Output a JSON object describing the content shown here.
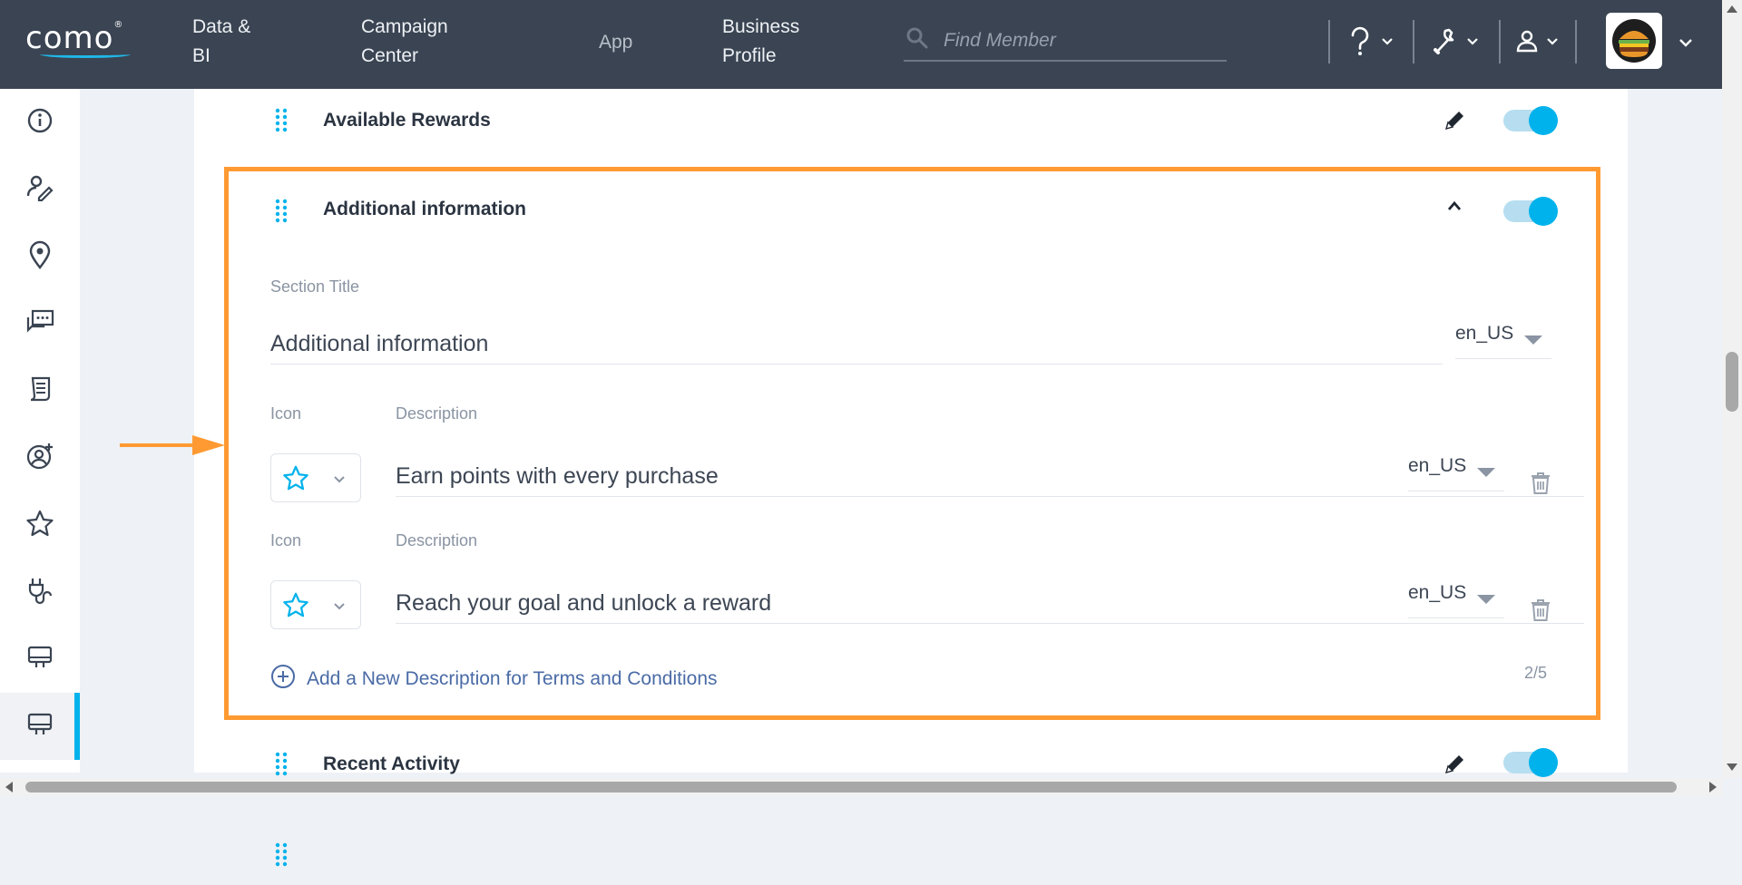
{
  "header": {
    "logo_text": "como",
    "logo_mark": "®",
    "nav": [
      {
        "line1": "Data &",
        "line2": "BI"
      },
      {
        "line1": "Campaign",
        "line2": "Center"
      },
      {
        "line1": "App",
        "line2": ""
      },
      {
        "line1": "Business",
        "line2": "Profile"
      }
    ],
    "search_placeholder": "Find Member",
    "icons": [
      "help-icon",
      "wrench-icon",
      "user-icon"
    ],
    "avatar": "burger-logo"
  },
  "sidebar": {
    "items": [
      "info-icon",
      "user-edit-icon",
      "location-pin-icon",
      "chat-icon",
      "receipt-icon",
      "user-add-icon",
      "star-icon",
      "plug-icon",
      "monitor-icon",
      "monitor-icon"
    ],
    "active_index": 9
  },
  "sections": {
    "available_rewards": {
      "title": "Available Rewards",
      "enabled": true
    },
    "additional_info": {
      "title": "Additional information",
      "enabled": true,
      "section_title_label": "Section Title",
      "section_title_value": "Additional information",
      "section_title_locale": "en_US",
      "icon_label": "Icon",
      "description_label": "Description",
      "descriptions": [
        {
          "icon": "star-icon",
          "text": "Earn points with every purchase",
          "locale": "en_US"
        },
        {
          "icon": "star-icon",
          "text": "Reach your goal and unlock a reward",
          "locale": "en_US"
        }
      ],
      "add_link": "Add a New Description for Terms and Conditions",
      "counter": "2/5"
    },
    "recent_activity": {
      "title": "Recent Activity",
      "enabled": true
    }
  },
  "colors": {
    "topbar": "#3a4452",
    "accent": "#00b2ec",
    "highlight": "#ff9a32",
    "link": "#4a6ba6"
  }
}
